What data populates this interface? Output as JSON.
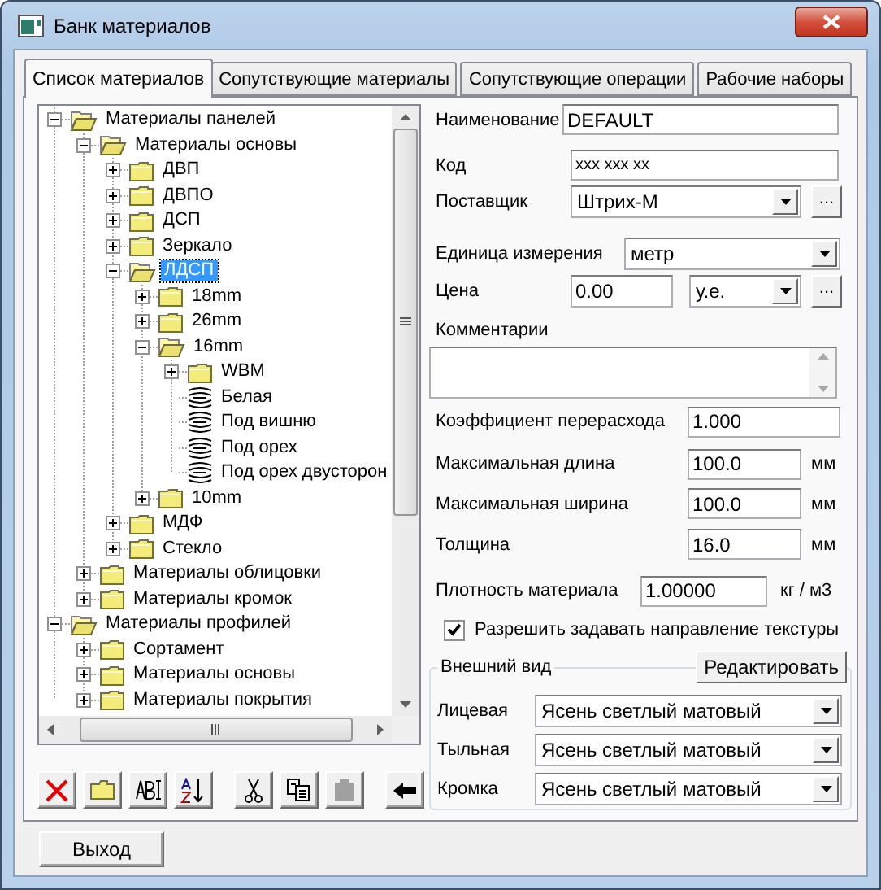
{
  "window": {
    "title": "Банк материалов"
  },
  "tabs": [
    {
      "label": "Список материалов",
      "selected": true
    },
    {
      "label": "Сопутствующие материалы",
      "selected": false
    },
    {
      "label": "Сопутствующие операции",
      "selected": false
    },
    {
      "label": "Рабочие наборы",
      "selected": false
    }
  ],
  "tree": {
    "items": [
      {
        "label": "Материалы панелей",
        "kind": "folder",
        "expanded": true,
        "selected": false,
        "children": [
          {
            "label": "Материалы основы",
            "kind": "folder",
            "expanded": true,
            "selected": false,
            "children": [
              {
                "label": "ДВП",
                "kind": "folder",
                "expanded": false,
                "selected": false
              },
              {
                "label": "ДВПО",
                "kind": "folder",
                "expanded": false,
                "selected": false
              },
              {
                "label": "ДСП",
                "kind": "folder",
                "expanded": false,
                "selected": false
              },
              {
                "label": "Зеркало",
                "kind": "folder",
                "expanded": false,
                "selected": false
              },
              {
                "label": "ЛДСП",
                "kind": "folder",
                "expanded": true,
                "selected": true,
                "children": [
                  {
                    "label": "18mm",
                    "kind": "folder",
                    "expanded": false,
                    "selected": false
                  },
                  {
                    "label": "26mm",
                    "kind": "folder",
                    "expanded": false,
                    "selected": false
                  },
                  {
                    "label": "16mm",
                    "kind": "folder",
                    "expanded": true,
                    "selected": false,
                    "children": [
                      {
                        "label": "WBM",
                        "kind": "folder",
                        "expanded": false,
                        "selected": false
                      },
                      {
                        "label": "Белая",
                        "kind": "texture",
                        "selected": false
                      },
                      {
                        "label": "Под вишню",
                        "kind": "texture",
                        "selected": false
                      },
                      {
                        "label": "Под орех",
                        "kind": "texture",
                        "selected": false
                      },
                      {
                        "label": "Под орех двусторон",
                        "kind": "texture",
                        "selected": false
                      }
                    ]
                  },
                  {
                    "label": "10mm",
                    "kind": "folder",
                    "expanded": false,
                    "selected": false
                  }
                ]
              },
              {
                "label": "МДФ",
                "kind": "folder",
                "expanded": false,
                "selected": false
              },
              {
                "label": "Стекло",
                "kind": "folder",
                "expanded": false,
                "selected": false
              }
            ]
          },
          {
            "label": "Материалы облицовки",
            "kind": "folder",
            "expanded": false,
            "selected": false
          },
          {
            "label": "Материалы кромок",
            "kind": "folder",
            "expanded": false,
            "selected": false
          }
        ]
      },
      {
        "label": "Материалы профилей",
        "kind": "folder",
        "expanded": true,
        "selected": false,
        "children": [
          {
            "label": "Сортамент",
            "kind": "folder",
            "expanded": false,
            "selected": false
          },
          {
            "label": "Материалы основы",
            "kind": "folder",
            "expanded": false,
            "selected": false
          },
          {
            "label": "Материалы покрытия",
            "kind": "folder",
            "expanded": false,
            "selected": false
          }
        ]
      }
    ]
  },
  "toolbar": {
    "groups": [
      {
        "buttons": [
          {
            "kind": "delete",
            "disabled": false
          },
          {
            "kind": "folder",
            "disabled": false
          },
          {
            "kind": "rename",
            "disabled": false
          },
          {
            "kind": "sort",
            "disabled": false
          }
        ]
      },
      {
        "buttons": [
          {
            "kind": "cut",
            "disabled": false
          },
          {
            "kind": "copy",
            "disabled": false
          },
          {
            "kind": "paste",
            "disabled": true
          }
        ]
      },
      {
        "buttons": [
          {
            "kind": "move",
            "disabled": false
          }
        ]
      }
    ]
  },
  "form": {
    "name": {
      "label": "Наименование",
      "value": "DEFAULT"
    },
    "code": {
      "label": "Код",
      "value": "xxx xxx xx"
    },
    "supplier": {
      "label": "Поставщик",
      "value": "Штрих-М",
      "button": "..."
    },
    "unit": {
      "label": "Единица измерения",
      "value": "метр"
    },
    "price": {
      "label": "Цена",
      "value": "0.00",
      "currency": "у.е.",
      "button": "..."
    },
    "comments": {
      "label": "Комментарии"
    },
    "waste_factor": {
      "label": "Коэффициент перерасхода",
      "value": "1.000"
    },
    "max_length": {
      "label": "Максимальная длина",
      "value": "100.0",
      "unit": "мм"
    },
    "max_width": {
      "label": "Максимальная ширина",
      "value": "100.0",
      "unit": "мм"
    },
    "thickness": {
      "label": "Толщина",
      "value": "16.0",
      "unit": "мм"
    },
    "density": {
      "label": "Плотность материала",
      "value": "1.00000",
      "unit": "кг / м3"
    },
    "texture_direction": {
      "label": "Разрешить задавать направление текстуры",
      "checked": true
    }
  },
  "appearance": {
    "title": "Внешний вид",
    "edit_button": "Редактировать",
    "rows": [
      {
        "label": "Лицевая",
        "value": "Ясень светлый матовый"
      },
      {
        "label": "Тыльная",
        "value": "Ясень светлый матовый"
      },
      {
        "label": "Кромка",
        "value": "Ясень светлый матовый"
      }
    ]
  },
  "exit_button": "Выход"
}
